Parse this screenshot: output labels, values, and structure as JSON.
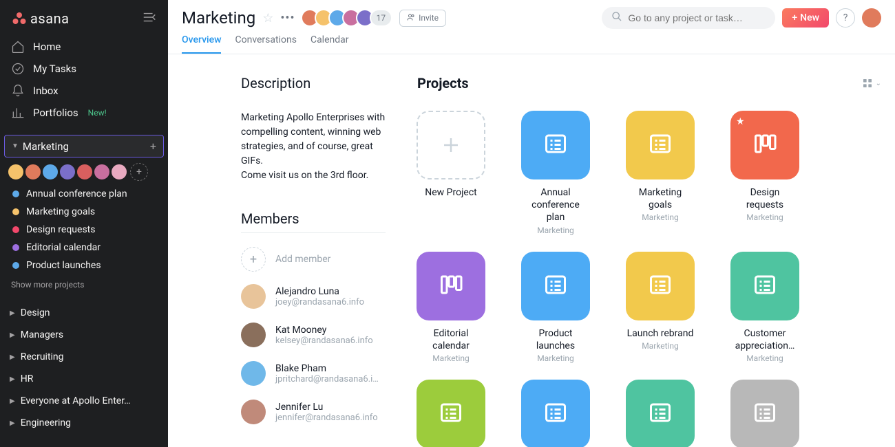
{
  "brand": "asana",
  "sidebar": {
    "nav": [
      {
        "label": "Home"
      },
      {
        "label": "My Tasks"
      },
      {
        "label": "Inbox"
      },
      {
        "label": "Portfolios",
        "badge": "New!"
      }
    ],
    "team": {
      "label": "Marketing"
    },
    "projects": [
      {
        "label": "Annual conference plan",
        "color": "#5da9e9"
      },
      {
        "label": "Marketing goals",
        "color": "#f5c26b"
      },
      {
        "label": "Design requests",
        "color": "#f2486b"
      },
      {
        "label": "Editorial calendar",
        "color": "#9d6fe0"
      },
      {
        "label": "Product launches",
        "color": "#5da9e9"
      }
    ],
    "show_more": "Show more projects",
    "groups": [
      {
        "label": "Design"
      },
      {
        "label": "Managers"
      },
      {
        "label": "Recruiting"
      },
      {
        "label": "HR"
      },
      {
        "label": "Everyone at Apollo Enter…"
      },
      {
        "label": "Engineering"
      }
    ]
  },
  "header": {
    "title": "Marketing",
    "avatar_count": "17",
    "invite_label": "Invite",
    "search_placeholder": "Go to any project or task…",
    "new_label": "New",
    "tabs": [
      {
        "label": "Overview",
        "active": true
      },
      {
        "label": "Conversations"
      },
      {
        "label": "Calendar"
      }
    ]
  },
  "description": {
    "heading": "Description",
    "body1": "Marketing Apollo Enterprises with compelling content, winning web strategies, and of course, great GIFs.",
    "body2": "Come visit us on the 3rd floor."
  },
  "members": {
    "heading": "Members",
    "add_label": "Add member",
    "list": [
      {
        "name": "Alejandro Luna",
        "email": "joey@randasana6.info",
        "color": "#e8c49a"
      },
      {
        "name": "Kat Mooney",
        "email": "kelsey@randasana6.info",
        "color": "#8a6f5c"
      },
      {
        "name": "Blake Pham",
        "email": "jpritchard@randasana6.i…",
        "color": "#6fb8e9"
      },
      {
        "name": "Jennifer Lu",
        "email": "jennifer@randasana6.info",
        "color": "#c08a7a"
      }
    ]
  },
  "projects_section": {
    "heading": "Projects",
    "new_label": "New Project",
    "team_label": "Marketing",
    "cards": [
      {
        "name": "Annual conference plan",
        "color": "#4dabf5",
        "icon": "list"
      },
      {
        "name": "Marketing goals",
        "color": "#f2c94c",
        "icon": "list"
      },
      {
        "name": "Design requests",
        "color": "#f2684c",
        "icon": "board",
        "starred": true
      },
      {
        "name": "Editorial calendar",
        "color": "#9d6fe0",
        "icon": "board"
      },
      {
        "name": "Product launches",
        "color": "#4dabf5",
        "icon": "list"
      },
      {
        "name": "Launch rebrand",
        "color": "#f2c94c",
        "icon": "list"
      },
      {
        "name": "Customer appreciation…",
        "color": "#4fc4a0",
        "icon": "list"
      },
      {
        "name": "",
        "color": "#9ccc3c",
        "icon": "list"
      },
      {
        "name": "",
        "color": "#4dabf5",
        "icon": "list"
      },
      {
        "name": "",
        "color": "#4fc4a0",
        "icon": "list"
      },
      {
        "name": "",
        "color": "#b8b8b8",
        "icon": "list"
      }
    ]
  }
}
